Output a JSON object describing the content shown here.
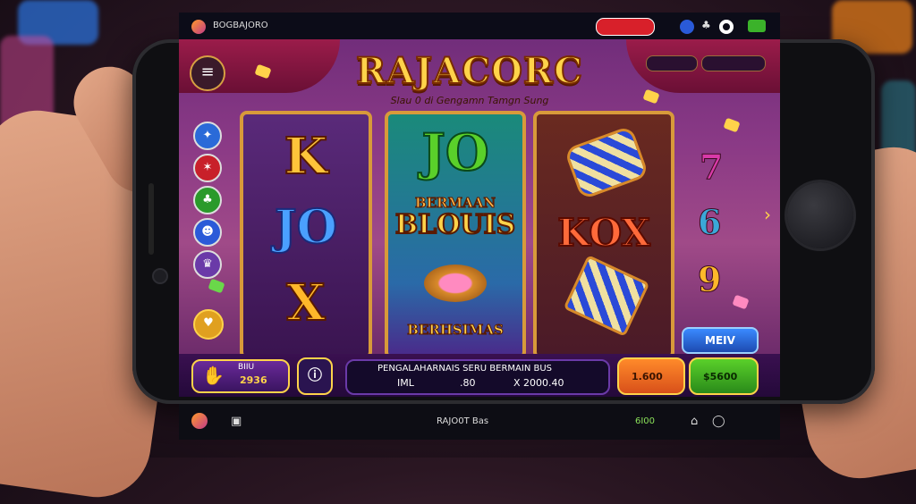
{
  "topbar": {
    "back_icon": "chevron-left-icon",
    "app_name": "BOGBAJORO",
    "status_pill_label": "",
    "icons": [
      "app-logo-icon",
      "hat-icon",
      "cards-icon",
      "settings-icon",
      "battery-icon"
    ]
  },
  "game": {
    "title": "RAJACORC",
    "subtitle": "Slau 0 di Gengamn Tamgn Sung",
    "top_pills": [
      "",
      ""
    ],
    "side_icons": [
      "bird-icon",
      "crab-icon",
      "clover-icon",
      "mask-icon",
      "crown-icon"
    ],
    "reels": [
      {
        "symbols": [
          "K",
          "JO",
          "X"
        ]
      },
      {
        "symbols": [
          "JO",
          "BERMAAN",
          "BLOUIS",
          "BERHSIMAS"
        ]
      },
      {
        "symbols": [
          "KOX"
        ]
      }
    ],
    "side_numbers": [
      "7",
      "6",
      "9"
    ],
    "menu_button": "MEIV"
  },
  "bottom": {
    "bet_label": "BIIU",
    "bet_value": "2936",
    "message": "PENGALAHARNAIS SERU BERMAIN BUS",
    "stat_left": "IML",
    "stat_mid": ".80",
    "stat_right": "X 2000.40",
    "orange_value": "1.600",
    "green_value": "$5600"
  },
  "navbar": {
    "center_label": "RAJO0T Bas",
    "right_label": "6I00"
  },
  "colors": {
    "accent_gold": "#ffd34a",
    "orange_button": "#e8651a",
    "green_button": "#3bb22a",
    "blue_button": "#1d5ad0"
  }
}
